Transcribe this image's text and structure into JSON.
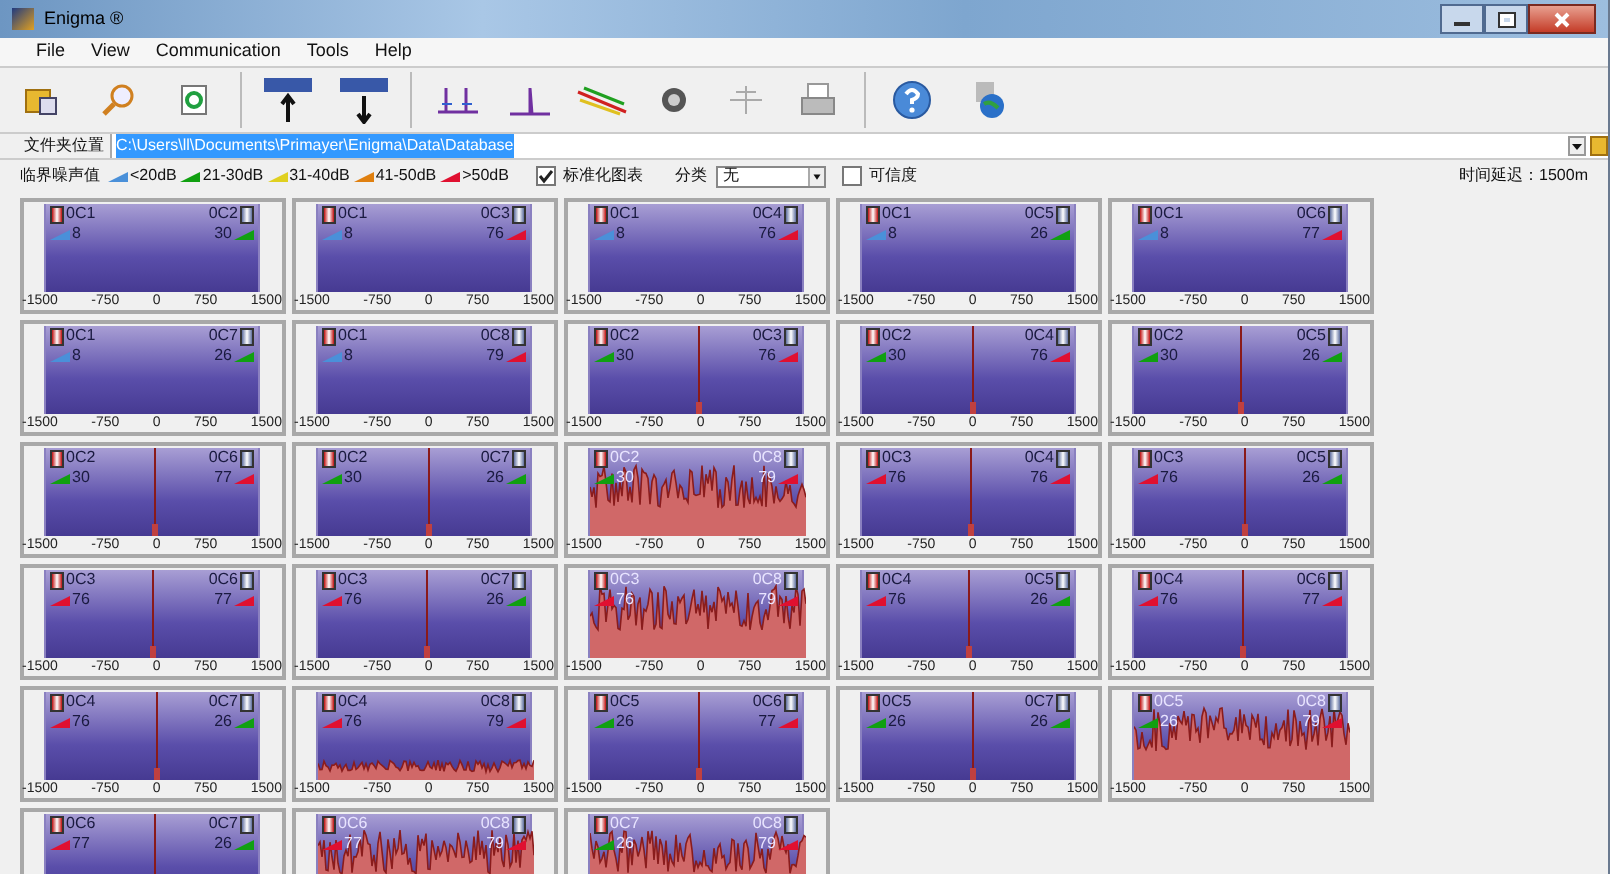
{
  "window": {
    "title": "Enigma ®"
  },
  "menu": [
    "File",
    "View",
    "Communication",
    "Tools",
    "Help"
  ],
  "path_row": {
    "label": "文件夹位置",
    "value": "C:\\Users\\ll\\Documents\\Primayer\\Enigma\\Data\\Database",
    "highlighted": true
  },
  "legend": {
    "label": "临界噪声值",
    "items": [
      {
        "label": "<20dB",
        "color": "#4a90d9"
      },
      {
        "label": "21-30dB",
        "color": "#10a010"
      },
      {
        "label": "31-40dB",
        "color": "#e0d020"
      },
      {
        "label": "41-50dB",
        "color": "#e08010"
      },
      {
        "label": ">50dB",
        "color": "#e01030"
      }
    ]
  },
  "normalize": {
    "label": "标准化图表",
    "checked": true
  },
  "category": {
    "label": "分类",
    "value": "无"
  },
  "confidence": {
    "label": "可信度",
    "checked": false
  },
  "delay": "时间延迟：1500m",
  "panels": [
    {
      "left": {
        "name": "0C1",
        "noise": "8",
        "color": "#4a90d9"
      },
      "right": {
        "name": "0C2",
        "noise": "30",
        "color": "#10a010"
      },
      "kind": "flat",
      "ticks": [
        "-1500",
        "-750",
        "0",
        "750",
        "1500"
      ]
    },
    {
      "left": {
        "name": "0C1",
        "noise": "8",
        "color": "#4a90d9"
      },
      "right": {
        "name": "0C3",
        "noise": "76",
        "color": "#e01030"
      },
      "kind": "flat",
      "ticks": [
        "-1500",
        "-750",
        "0",
        "750",
        "1500"
      ]
    },
    {
      "left": {
        "name": "0C1",
        "noise": "8",
        "color": "#4a90d9"
      },
      "right": {
        "name": "0C4",
        "noise": "76",
        "color": "#e01030"
      },
      "kind": "flat",
      "ticks": [
        "-1500",
        "-750",
        "0",
        "750",
        "1500"
      ]
    },
    {
      "left": {
        "name": "0C1",
        "noise": "8",
        "color": "#4a90d9"
      },
      "right": {
        "name": "0C5",
        "noise": "26",
        "color": "#10a010"
      },
      "kind": "flat",
      "ticks": [
        "-1500",
        "-750",
        "0",
        "750",
        "1500"
      ]
    },
    {
      "left": {
        "name": "0C1",
        "noise": "8",
        "color": "#4a90d9"
      },
      "right": {
        "name": "0C6",
        "noise": "77",
        "color": "#e01030"
      },
      "kind": "flat",
      "ticks": [
        "-1500",
        "-750",
        "0",
        "750",
        "1500"
      ]
    },
    {
      "left": {
        "name": "0C1",
        "noise": "8",
        "color": "#4a90d9"
      },
      "right": {
        "name": "0C7",
        "noise": "26",
        "color": "#10a010"
      },
      "kind": "flat",
      "ticks": [
        "-1500",
        "-750",
        "0",
        "750",
        "1500"
      ]
    },
    {
      "left": {
        "name": "0C1",
        "noise": "8",
        "color": "#4a90d9"
      },
      "right": {
        "name": "0C8",
        "noise": "79",
        "color": "#e01030"
      },
      "kind": "flat",
      "ticks": [
        "-1500",
        "-750",
        "0",
        "750",
        "1500"
      ]
    },
    {
      "left": {
        "name": "0C2",
        "noise": "30",
        "color": "#10a010"
      },
      "right": {
        "name": "0C3",
        "noise": "76",
        "color": "#e01030"
      },
      "kind": "spike",
      "ticks": [
        "-1500",
        "-750",
        "0",
        "750",
        "1500"
      ]
    },
    {
      "left": {
        "name": "0C2",
        "noise": "30",
        "color": "#10a010"
      },
      "right": {
        "name": "0C4",
        "noise": "76",
        "color": "#e01030"
      },
      "kind": "spike",
      "ticks": [
        "-1500",
        "-750",
        "0",
        "750",
        "1500"
      ]
    },
    {
      "left": {
        "name": "0C2",
        "noise": "30",
        "color": "#10a010"
      },
      "right": {
        "name": "0C5",
        "noise": "26",
        "color": "#10a010"
      },
      "kind": "spike",
      "ticks": [
        "-1500",
        "-750",
        "0",
        "750",
        "1500"
      ]
    },
    {
      "left": {
        "name": "0C2",
        "noise": "30",
        "color": "#10a010"
      },
      "right": {
        "name": "0C6",
        "noise": "77",
        "color": "#e01030"
      },
      "kind": "spike",
      "ticks": [
        "-1500",
        "-750",
        "0",
        "750",
        "1500"
      ]
    },
    {
      "left": {
        "name": "0C2",
        "noise": "30",
        "color": "#10a010"
      },
      "right": {
        "name": "0C7",
        "noise": "26",
        "color": "#10a010"
      },
      "kind": "spike",
      "ticks": [
        "-1500",
        "-750",
        "0",
        "750",
        "1500"
      ]
    },
    {
      "left": {
        "name": "0C2",
        "noise": "30",
        "color": "#10a010"
      },
      "right": {
        "name": "0C8",
        "noise": "79",
        "color": "#e01030"
      },
      "kind": "noise",
      "ticks": [
        "-1500",
        "-750",
        "0",
        "750",
        "1500"
      ]
    },
    {
      "left": {
        "name": "0C3",
        "noise": "76",
        "color": "#e01030"
      },
      "right": {
        "name": "0C4",
        "noise": "76",
        "color": "#e01030"
      },
      "kind": "spike",
      "ticks": [
        "-1500",
        "-750",
        "0",
        "750",
        "1500"
      ]
    },
    {
      "left": {
        "name": "0C3",
        "noise": "76",
        "color": "#e01030"
      },
      "right": {
        "name": "0C5",
        "noise": "26",
        "color": "#10a010"
      },
      "kind": "spike",
      "ticks": [
        "-1500",
        "-750",
        "0",
        "750",
        "1500"
      ]
    },
    {
      "left": {
        "name": "0C3",
        "noise": "76",
        "color": "#e01030"
      },
      "right": {
        "name": "0C6",
        "noise": "77",
        "color": "#e01030"
      },
      "kind": "spike",
      "ticks": [
        "-1500",
        "-750",
        "0",
        "750",
        "1500"
      ]
    },
    {
      "left": {
        "name": "0C3",
        "noise": "76",
        "color": "#e01030"
      },
      "right": {
        "name": "0C7",
        "noise": "26",
        "color": "#10a010"
      },
      "kind": "spike",
      "ticks": [
        "-1500",
        "-750",
        "0",
        "750",
        "1500"
      ]
    },
    {
      "left": {
        "name": "0C3",
        "noise": "76",
        "color": "#e01030"
      },
      "right": {
        "name": "0C8",
        "noise": "79",
        "color": "#e01030"
      },
      "kind": "noise",
      "ticks": [
        "-1500",
        "-750",
        "0",
        "750",
        "1500"
      ]
    },
    {
      "left": {
        "name": "0C4",
        "noise": "76",
        "color": "#e01030"
      },
      "right": {
        "name": "0C5",
        "noise": "26",
        "color": "#10a010"
      },
      "kind": "spike",
      "ticks": [
        "-1500",
        "-750",
        "0",
        "750",
        "1500"
      ]
    },
    {
      "left": {
        "name": "0C4",
        "noise": "76",
        "color": "#e01030"
      },
      "right": {
        "name": "0C6",
        "noise": "77",
        "color": "#e01030"
      },
      "kind": "spike",
      "ticks": [
        "-1500",
        "-750",
        "0",
        "750",
        "1500"
      ]
    },
    {
      "left": {
        "name": "0C4",
        "noise": "76",
        "color": "#e01030"
      },
      "right": {
        "name": "0C7",
        "noise": "26",
        "color": "#10a010"
      },
      "kind": "spike",
      "ticks": [
        "-1500",
        "-750",
        "0",
        "750",
        "1500"
      ]
    },
    {
      "left": {
        "name": "0C4",
        "noise": "76",
        "color": "#e01030"
      },
      "right": {
        "name": "0C8",
        "noise": "79",
        "color": "#e01030"
      },
      "kind": "low_noise",
      "ticks": [
        "-1500",
        "-750",
        "0",
        "750",
        "1500"
      ]
    },
    {
      "left": {
        "name": "0C5",
        "noise": "26",
        "color": "#10a010"
      },
      "right": {
        "name": "0C6",
        "noise": "77",
        "color": "#e01030"
      },
      "kind": "spike",
      "ticks": [
        "-1500",
        "-750",
        "0",
        "750",
        "1500"
      ]
    },
    {
      "left": {
        "name": "0C5",
        "noise": "26",
        "color": "#10a010"
      },
      "right": {
        "name": "0C7",
        "noise": "26",
        "color": "#10a010"
      },
      "kind": "spike",
      "ticks": [
        "-1500",
        "-750",
        "0",
        "750",
        "1500"
      ]
    },
    {
      "left": {
        "name": "0C5",
        "noise": "26",
        "color": "#10a010"
      },
      "right": {
        "name": "0C8",
        "noise": "79",
        "color": "#e01030"
      },
      "kind": "noise",
      "ticks": [
        "-1500",
        "-750",
        "0",
        "750",
        "1500"
      ]
    },
    {
      "left": {
        "name": "0C6",
        "noise": "77",
        "color": "#e01030"
      },
      "right": {
        "name": "0C7",
        "noise": "26",
        "color": "#10a010"
      },
      "kind": "spike"
    },
    {
      "left": {
        "name": "0C6",
        "noise": "77",
        "color": "#e01030"
      },
      "right": {
        "name": "0C8",
        "noise": "79",
        "color": "#e01030"
      },
      "kind": "noise"
    },
    {
      "left": {
        "name": "0C7",
        "noise": "26",
        "color": "#10a010"
      },
      "right": {
        "name": "0C8",
        "noise": "79",
        "color": "#e01030"
      },
      "kind": "noise"
    }
  ]
}
